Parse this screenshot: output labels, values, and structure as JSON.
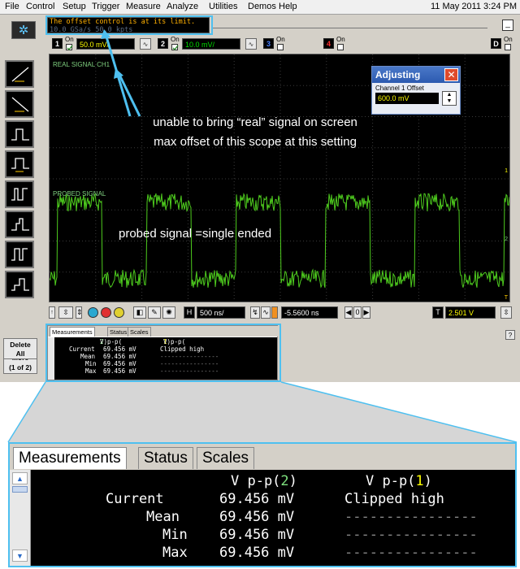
{
  "menu": {
    "items": [
      "File",
      "Control",
      "Setup",
      "Trigger",
      "Measure",
      "Analyze",
      "Utilities",
      "Demos",
      "Help"
    ],
    "datetime": "11 May 2011  3:24 PM"
  },
  "message": {
    "line1": "The offset control is at its limit.",
    "line2": "10.0 GSa/s  50.0 kpts"
  },
  "minimize_label": "_",
  "channels": [
    {
      "num": "1",
      "on_label": "On",
      "scale": "50.0 mV/",
      "color": "#ffff00",
      "checked": true
    },
    {
      "num": "2",
      "on_label": "On",
      "scale": "10.0 mV/",
      "color": "#00c000",
      "checked": true
    },
    {
      "num": "3",
      "on_label": "On",
      "color": "#4a80ff",
      "checked": false
    },
    {
      "num": "4",
      "on_label": "On",
      "color": "#ff3030",
      "checked": false
    },
    {
      "num": "D",
      "on_label": "On",
      "color": "#ffffff",
      "checked": false
    }
  ],
  "left_toolbar": {
    "more": "More\n(1 of 2)",
    "delete": "Delete\nAll"
  },
  "display": {
    "real_label": "REAL SIGNAL CH1",
    "probed_label": "PROBED SIGNAL",
    "marker_1": "1",
    "marker_2": "2",
    "marker_t": "T",
    "annotation_top": "unable to bring “real” signal on screen\nmax offset of this scope at this setting",
    "annotation_bottom": "probed signal =single ended"
  },
  "adjusting": {
    "title": "Adjusting",
    "close": "✕",
    "label": "Channel 1 Offset",
    "value": "600.0 mV"
  },
  "bottom_bar": {
    "timebase": "500 ns/",
    "position": "-5.5600 ns",
    "trigger_level": "2.501 V",
    "trigger_letter": "T",
    "h_letter": "H"
  },
  "measurements": {
    "tabs": [
      "Measurements",
      "Status",
      "Scales"
    ],
    "headers": {
      "col1_prefix": "V p-p(",
      "col1_ch": "2",
      "col2_prefix": "V p-p(",
      "col2_ch": "1",
      "suffix": ")"
    },
    "rows": [
      {
        "label": "Current",
        "v1": "69.456 mV",
        "v2": "Clipped high"
      },
      {
        "label": "Mean",
        "v1": "69.456 mV",
        "v2": "----------------"
      },
      {
        "label": "Min",
        "v1": "69.456 mV",
        "v2": "----------------"
      },
      {
        "label": "Max",
        "v1": "69.456 mV",
        "v2": "----------------"
      }
    ]
  },
  "help_label": "?",
  "colors": {
    "highlight": "#4ec0f0",
    "trace": "#4ecc1e",
    "ch1": "#ffff00"
  }
}
